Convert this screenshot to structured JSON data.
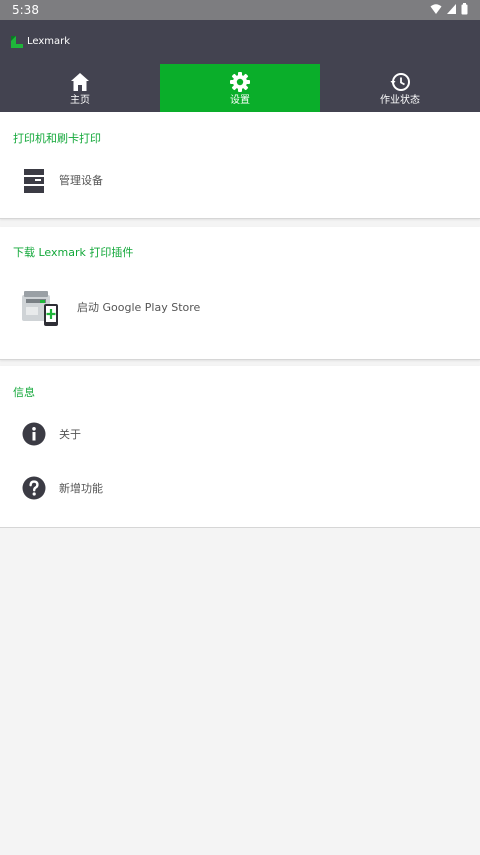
{
  "status_bar": {
    "time": "5:38",
    "icons": [
      "wifi-icon",
      "signal-icon",
      "battery-icon"
    ]
  },
  "app": {
    "brand": "Lexmark",
    "colors": {
      "appbar": "#434350",
      "accent": "#0aae2a",
      "section_title": "#13a83a"
    }
  },
  "tabs": [
    {
      "label": "主页",
      "icon": "home-icon",
      "active": false
    },
    {
      "label": "设置",
      "icon": "gear-icon",
      "active": true
    },
    {
      "label": "作业状态",
      "icon": "history-icon",
      "active": false
    }
  ],
  "sections": [
    {
      "title": "打印机和刷卡打印",
      "items": [
        {
          "label": "管理设备",
          "icon": "printer-icon"
        }
      ]
    },
    {
      "title": "下载 Lexmark 打印插件",
      "items": [
        {
          "label": "启动 Google Play Store",
          "icon": "printer-plugin-icon"
        }
      ]
    },
    {
      "title": "信息",
      "items": [
        {
          "label": "关于",
          "icon": "info-icon"
        },
        {
          "label": "新增功能",
          "icon": "help-icon"
        }
      ]
    }
  ]
}
